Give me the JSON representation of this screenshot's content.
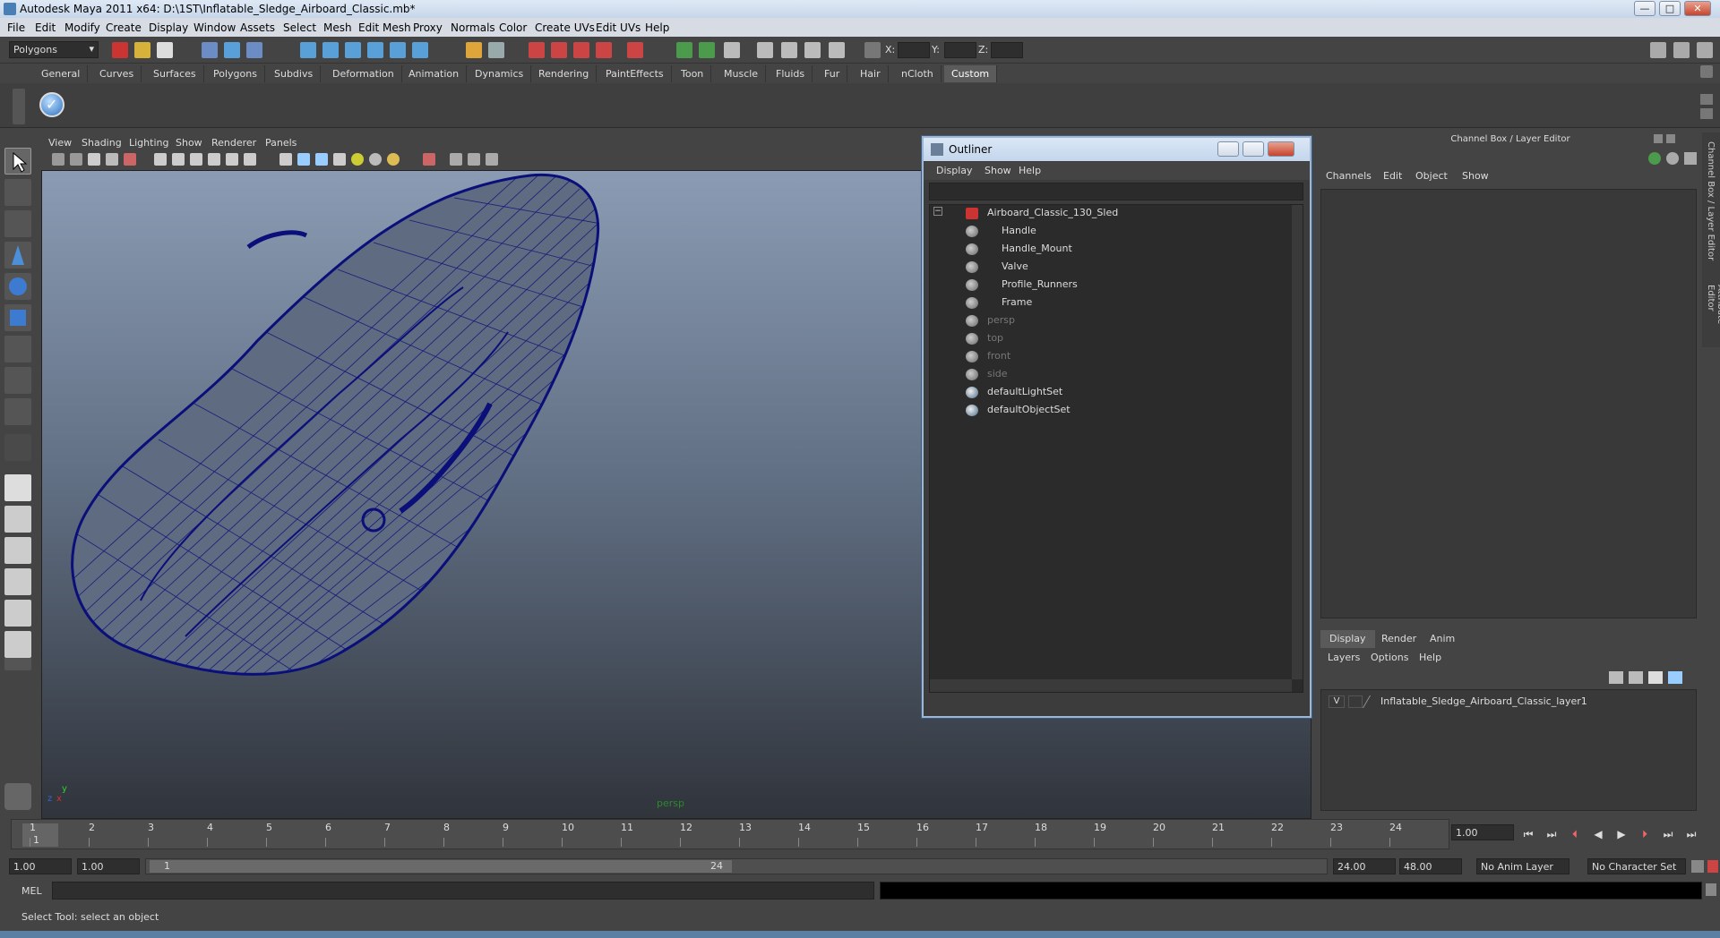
{
  "window": {
    "title": "Autodesk Maya 2011 x64: D:\\1ST\\Inflatable_Sledge_Airboard_Classic.mb*",
    "minimize": "—",
    "maximize": "□",
    "close": "✕"
  },
  "menubar": [
    "File",
    "Edit",
    "Modify",
    "Create",
    "Display",
    "Window",
    "Assets",
    "Select",
    "Mesh",
    "Edit Mesh",
    "Proxy",
    "Normals",
    "Color",
    "Create UVs",
    "Edit UVs",
    "Help"
  ],
  "statusline": {
    "mode": "Polygons",
    "x_label": "X:",
    "y_label": "Y:",
    "z_label": "Z:"
  },
  "shelf_tabs": [
    "General",
    "Curves",
    "Surfaces",
    "Polygons",
    "Subdivs",
    "Deformation",
    "Animation",
    "Dynamics",
    "Rendering",
    "PaintEffects",
    "Toon",
    "Muscle",
    "Fluids",
    "Fur",
    "Hair",
    "nCloth",
    "Custom"
  ],
  "active_shelf": "Custom",
  "viewport": {
    "menu": [
      "View",
      "Shading",
      "Lighting",
      "Show",
      "Renderer",
      "Panels"
    ],
    "camera_label": "persp",
    "axis_x": "x",
    "axis_y": "y",
    "axis_z": "z"
  },
  "outliner": {
    "title": "Outliner",
    "menu": [
      "Display",
      "Show",
      "Help"
    ],
    "expand_sign": "−",
    "items": [
      {
        "label": "Airboard_Classic_130_Sled",
        "level": 0,
        "dim": false
      },
      {
        "label": "Handle",
        "level": 1,
        "dim": false
      },
      {
        "label": "Handle_Mount",
        "level": 1,
        "dim": false
      },
      {
        "label": "Valve",
        "level": 1,
        "dim": false
      },
      {
        "label": "Profile_Runners",
        "level": 1,
        "dim": false
      },
      {
        "label": "Frame",
        "level": 1,
        "dim": false
      },
      {
        "label": "persp",
        "level": 0,
        "dim": true
      },
      {
        "label": "top",
        "level": 0,
        "dim": true
      },
      {
        "label": "front",
        "level": 0,
        "dim": true
      },
      {
        "label": "side",
        "level": 0,
        "dim": true
      },
      {
        "label": "defaultLightSet",
        "level": 0,
        "dim": false
      },
      {
        "label": "defaultObjectSet",
        "level": 0,
        "dim": false
      }
    ]
  },
  "channel_box": {
    "header": "Channel Box / Layer Editor",
    "menu": [
      "Channels",
      "Edit",
      "Object",
      "Show"
    ],
    "layer_tabs": [
      "Display",
      "Render",
      "Anim"
    ],
    "layer_menu": [
      "Layers",
      "Options",
      "Help"
    ],
    "layer": {
      "visible": "V",
      "name": "Inflatable_Sledge_Airboard_Classic_layer1"
    },
    "side_tabs": [
      "Channel Box / Layer Editor",
      "Attribute Editor"
    ]
  },
  "timeline": {
    "ticks": [
      "1",
      "2",
      "3",
      "4",
      "5",
      "6",
      "7",
      "8",
      "9",
      "10",
      "11",
      "12",
      "13",
      "14",
      "15",
      "16",
      "17",
      "18",
      "19",
      "20",
      "21",
      "22",
      "23",
      "24"
    ],
    "current_frame_marker": "1",
    "current_time": "1.00"
  },
  "range": {
    "start": "1.00",
    "playback_start": "1.00",
    "slider_start": "1",
    "slider_end": "24",
    "playback_end": "24.00",
    "end": "48.00",
    "anim_layer": "No Anim Layer",
    "char_set": "No Character Set"
  },
  "command_line": {
    "label": "MEL"
  },
  "help_line": "Select Tool: select an object",
  "colors": {
    "wire": "#0b0f7a",
    "accent": "#9fb6d3"
  }
}
